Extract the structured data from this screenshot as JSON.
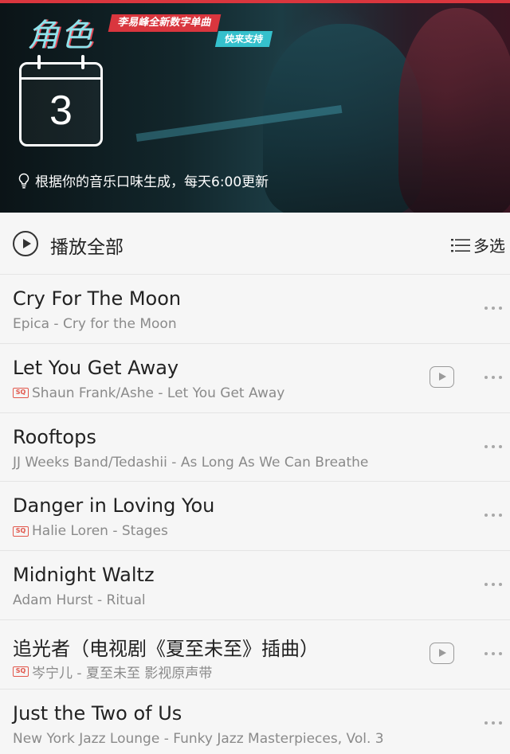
{
  "banner": {
    "logo_text": "角色",
    "promo_primary": "李易峰全新数字单曲",
    "promo_secondary": "快来支持",
    "calendar_day": "3",
    "hint_text": "根据你的音乐口味生成，每天6:00更新",
    "hint_icon": "lightbulb-icon"
  },
  "controls": {
    "play_all_label": "播放全部",
    "play_icon": "play-circle-icon",
    "multi_select_label": "多选",
    "multi_select_icon": "list-icon"
  },
  "songs": [
    {
      "title": "Cry For The Moon",
      "subtitle": "Epica - Cry for the Moon",
      "sq": false,
      "mv": false
    },
    {
      "title": "Let You Get Away",
      "subtitle": "Shaun Frank/Ashe - Let You Get Away",
      "sq": true,
      "mv": true
    },
    {
      "title": "Rooftops",
      "subtitle": "JJ Weeks Band/Tedashii - As Long As We Can Breathe",
      "sq": false,
      "mv": false
    },
    {
      "title": "Danger in Loving You",
      "subtitle": "Halie Loren - Stages",
      "sq": true,
      "mv": false
    },
    {
      "title": "Midnight Waltz",
      "subtitle": "Adam Hurst - Ritual",
      "sq": false,
      "mv": false
    },
    {
      "title": "追光者（电视剧《夏至未至》插曲）",
      "subtitle": "岑宁儿 - 夏至未至 影视原声带",
      "sq": true,
      "mv": true
    },
    {
      "title": "Just the Two of Us",
      "subtitle": "New York Jazz Lounge - Funky Jazz Masterpieces, Vol. 3",
      "sq": false,
      "mv": false
    }
  ],
  "badge_text": "SQ",
  "colors": {
    "accent_red": "#d9363e",
    "accent_teal": "#35c0cc",
    "sq_badge": "#e2574c"
  }
}
